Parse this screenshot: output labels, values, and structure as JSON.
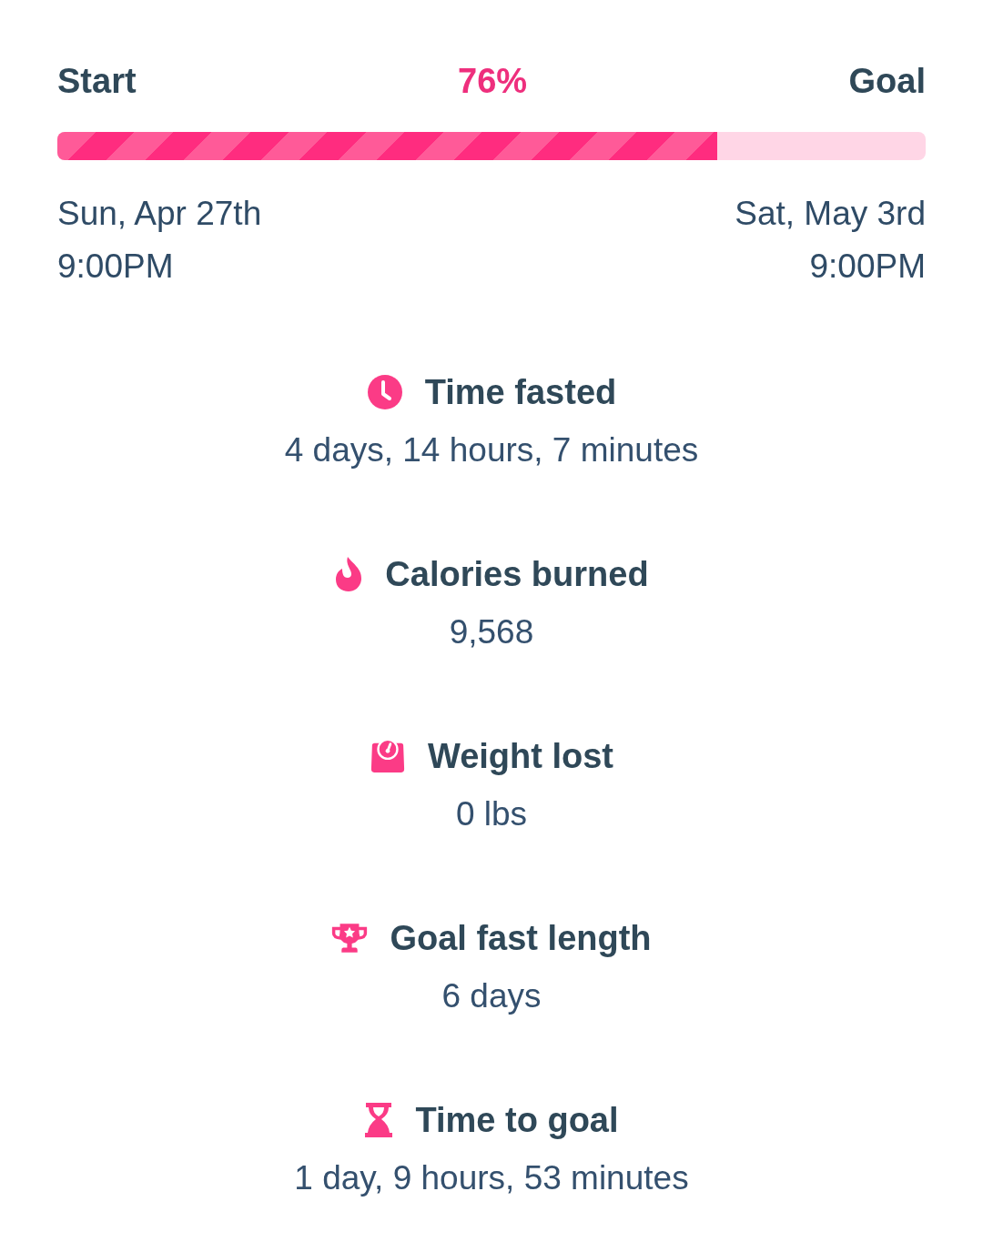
{
  "progress": {
    "start_label": "Start",
    "percent": "76%",
    "goal_label": "Goal",
    "level": 0.76,
    "start_date": "Sun, Apr 27th",
    "start_time": "9:00PM",
    "goal_date": "Sat, May 3rd",
    "goal_time": "9:00PM"
  },
  "stats": [
    {
      "title": "Time fasted",
      "value": "4 days, 14 hours, 7 minutes"
    },
    {
      "title": "Calories burned",
      "value": "9,568"
    },
    {
      "title": "Weight lost",
      "value": "0 lbs"
    },
    {
      "title": "Goal fast length",
      "value": "6 days"
    },
    {
      "title": "Time to goal",
      "value": "1 day, 9 hours, 53 minutes"
    }
  ]
}
